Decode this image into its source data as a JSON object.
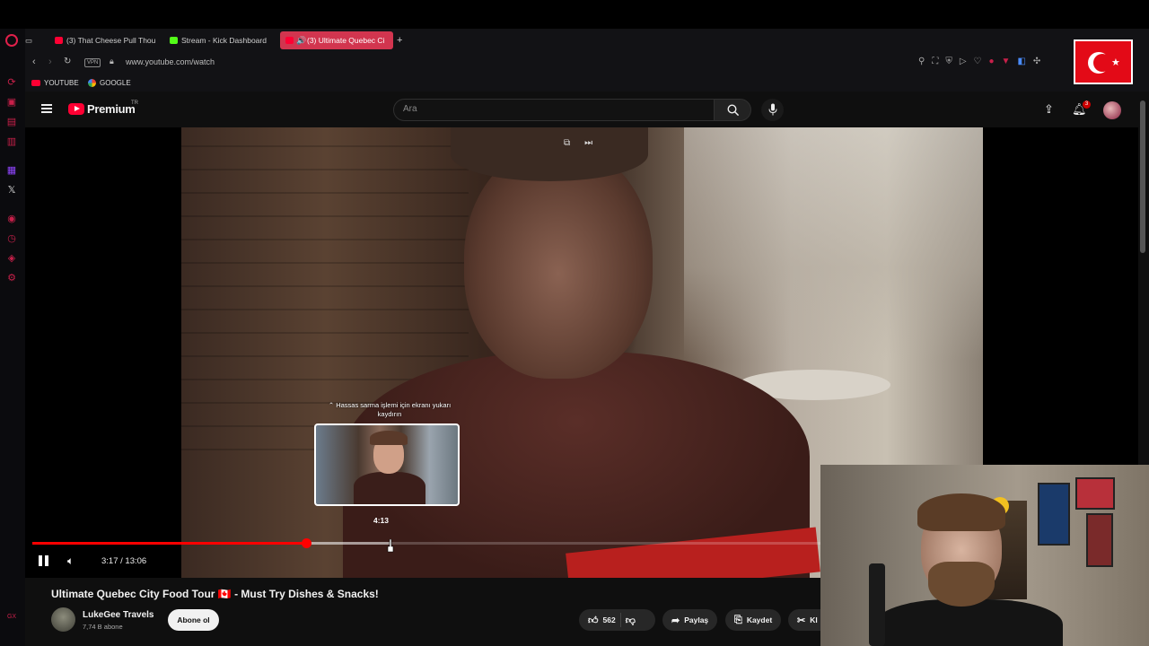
{
  "browser": {
    "tabs": [
      {
        "label": "(3) That Cheese Pull Thou",
        "color": "#ff0033"
      },
      {
        "label": "Stream - Kick Dashboard",
        "color": "#53fc18"
      },
      {
        "label": "(3) Ultimate Quebec Ci",
        "color": "#ff0033",
        "active": true
      }
    ],
    "new_tab": "+",
    "vpn_label": "VPN",
    "url": "www.youtube.com/watch",
    "bookmarks": [
      {
        "label": "YOUTUBE"
      },
      {
        "label": "GOOGLE"
      }
    ]
  },
  "youtube": {
    "brand": "Premium",
    "country_code": "TR",
    "search_placeholder": "Ara",
    "notification_count": "3"
  },
  "player": {
    "scrub_hint": "Hassas sarma işlemi için ekranı yukarı kaydırın",
    "preview_time": "4:13",
    "current_time": "3:17",
    "duration": "13:06",
    "time_display": "3:17 / 13:06",
    "progress_fraction": 0.347,
    "buffer_fraction": 0.455
  },
  "video": {
    "title": "Ultimate Quebec City Food Tour 🇨🇦 - Must Try Dishes & Snacks!",
    "channel": "LukeGee Travels",
    "subscribers": "7,74 B abone",
    "subscribe_label": "Abone ol",
    "likes": "562",
    "share_label": "Paylaş",
    "save_label": "Kaydet",
    "clip_label": "Kl"
  },
  "opera_sidebar": {
    "bottom_label": "GX"
  },
  "colors": {
    "accent": "#ff0000",
    "opera_accent": "#d2354f",
    "bg": "#0f0f0f"
  }
}
